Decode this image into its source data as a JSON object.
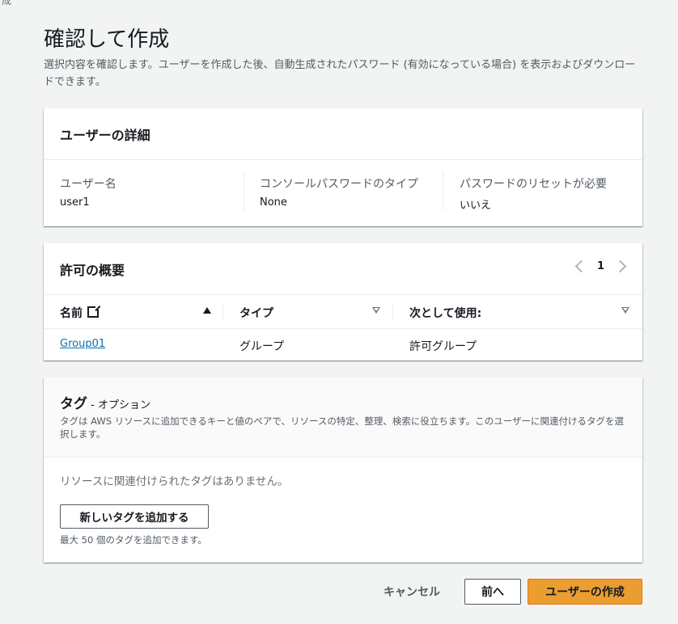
{
  "corner_text": "成",
  "page": {
    "title": "確認して作成",
    "description": "選択内容を確認します。ユーザーを作成した後、自動生成されたパスワード (有効になっている場合) を表示およびダウンロードできます。"
  },
  "user_details": {
    "title": "ユーザーの詳細",
    "fields": [
      {
        "label": "ユーザー名",
        "value": "user1"
      },
      {
        "label": "コンソールパスワードのタイプ",
        "value": "None"
      },
      {
        "label": "パスワードのリセットが必要",
        "value": "いいえ"
      }
    ]
  },
  "permissions": {
    "title": "許可の概要",
    "page_number": "1",
    "columns": [
      "名前",
      "タイプ",
      "次として使用:"
    ],
    "rows": [
      {
        "name": "Group01",
        "type": "グループ",
        "used_as": "許可グループ"
      }
    ]
  },
  "tags": {
    "title": "タグ",
    "optional": " - オプション",
    "description": "タグは AWS リソースに追加できるキーと値のペアで、リソースの特定、整理、検索に役立ちます。このユーザーに関連付けるタグを選択します。",
    "empty_message": "リソースに関連付けられたタグはありません。",
    "add_button": "新しいタグを追加する",
    "limit_note": "最大 50 個のタグを追加できます。"
  },
  "footer": {
    "cancel": "キャンセル",
    "previous": "前へ",
    "create": "ユーザーの作成"
  },
  "colors": {
    "primary_button": "#eb9e2f",
    "link": "#0073bb"
  }
}
